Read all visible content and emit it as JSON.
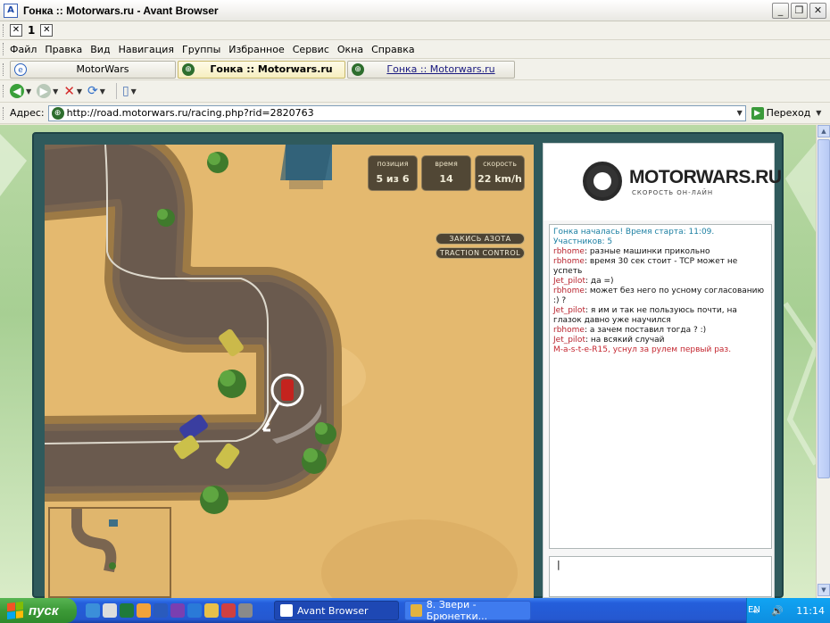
{
  "window": {
    "title": "Гонка :: Motorwars.ru - Avant Browser"
  },
  "toolbar1": {
    "number": "1"
  },
  "menu": [
    "Файл",
    "Правка",
    "Вид",
    "Навигация",
    "Группы",
    "Избранное",
    "Сервис",
    "Окна",
    "Справка"
  ],
  "tabs": [
    {
      "label": "MotorWars"
    },
    {
      "label": "Гонка :: Motorwars.ru"
    },
    {
      "label": "Гонка :: Motorwars.ru"
    }
  ],
  "address": {
    "label": "Адрес:",
    "url": "http://road.motorwars.ru/racing.php?rid=2820763",
    "go_label": "Переход"
  },
  "hud": [
    {
      "label": "позиция",
      "value": "5 из 6"
    },
    {
      "label": "время",
      "value": "14"
    },
    {
      "label": "скорость",
      "value": "22 km/h"
    }
  ],
  "game_buttons": {
    "nitro": "ЗАКИСЬ АЗОТА",
    "traction": "TRACTION CONTROL"
  },
  "logo": {
    "name": "MOTORWARS.RU",
    "tagline": "СКОРОСТЬ ОН-ЛАЙН"
  },
  "chat": {
    "system": "Гонка началась! Время старта: 11:09. Участников: 5",
    "messages": [
      {
        "nick": "rbhome",
        "text": "разные машинки прикольно"
      },
      {
        "nick": "rbhome",
        "text": "время 30 сек стоит - TCP может не успеть"
      },
      {
        "nick": "Jet_pilot",
        "text": "да =)"
      },
      {
        "nick": "rbhome",
        "text": "может без него по усному согласованию :) ?"
      },
      {
        "nick": "Jet_pilot",
        "text": "я им и так не пользуюсь почти, на глазок давно уже научился"
      },
      {
        "nick": "rbhome",
        "text": "а зачем поставил тогда ? :)"
      },
      {
        "nick": "Jet_pilot",
        "text": "на всякий случай"
      }
    ],
    "last": "M-a-s-t-e-R15, уснул за рулем первый раз.",
    "input_value": "|"
  },
  "taskbar": {
    "start": "пуск",
    "tasks": [
      "Avant Browser",
      "8. Звери - Брюнетки..."
    ],
    "lang": "EN",
    "clock": "11:14"
  }
}
